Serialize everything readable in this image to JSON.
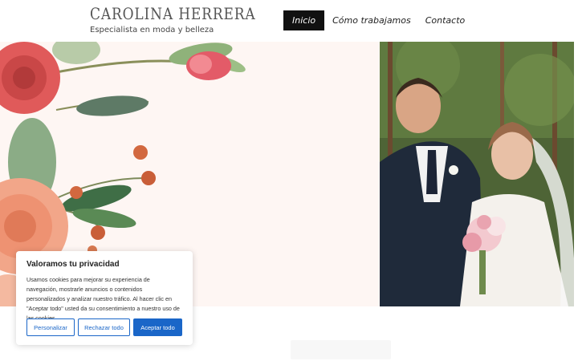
{
  "brand": {
    "name": "CAROLINA HERRERA",
    "tagline": "Especialista en moda y belleza"
  },
  "nav": {
    "items": [
      {
        "label": "Inicio",
        "active": true
      },
      {
        "label": "Cómo trabajamos",
        "active": false
      },
      {
        "label": "Contacto",
        "active": false
      }
    ]
  },
  "hero": {
    "left_image": "watercolor-floral-illustration",
    "right_image": "wedding-couple-photo"
  },
  "cookie": {
    "title": "Valoramos tu privacidad",
    "text": "Usamos cookies para mejorar su experiencia de navegación, mostrarle anuncios o contenidos personalizados y analizar nuestro tráfico. Al hacer clic en \"Aceptar todo\" usted da su consentimiento a nuestro uso de las cookies.",
    "customize_label": "Personalizar",
    "reject_label": "Rechazar todo",
    "accept_label": "Aceptar todo"
  },
  "colors": {
    "accent": "#1a66c8",
    "hero_bg": "#fef6f3",
    "nav_active": "#111111"
  }
}
